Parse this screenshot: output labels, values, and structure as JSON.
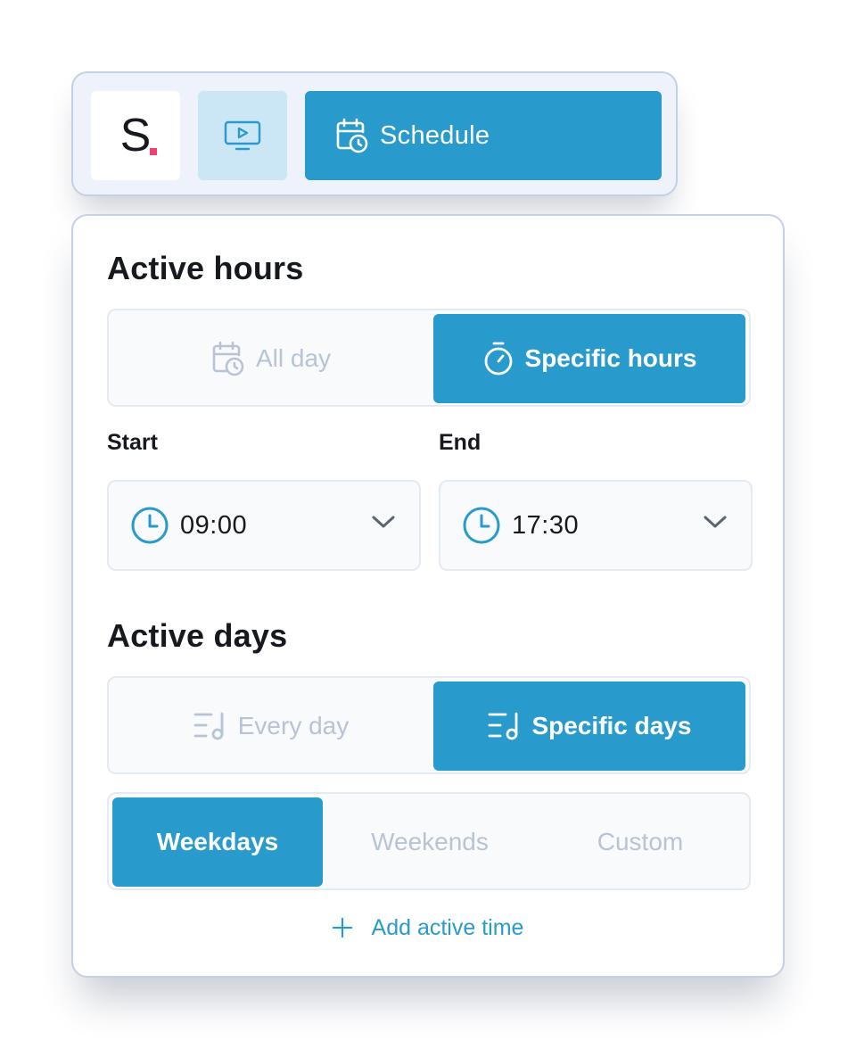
{
  "toolbar": {
    "logo_text": "S",
    "schedule_label": "Schedule"
  },
  "active_hours": {
    "title": "Active hours",
    "options": [
      {
        "label": "All day",
        "selected": false
      },
      {
        "label": "Specific hours",
        "selected": true
      }
    ],
    "start": {
      "label": "Start",
      "value": "09:00"
    },
    "end": {
      "label": "End",
      "value": "17:30"
    }
  },
  "active_days": {
    "title": "Active days",
    "options": [
      {
        "label": "Every day",
        "selected": false
      },
      {
        "label": "Specific days",
        "selected": true
      }
    ],
    "day_sets": [
      {
        "label": "Weekdays",
        "selected": true
      },
      {
        "label": "Weekends",
        "selected": false
      },
      {
        "label": "Custom",
        "selected": false
      }
    ]
  },
  "add_active_time_label": "Add active time",
  "colors": {
    "accent": "#289bcc",
    "accent_light": "#cbe6f4",
    "logo_dot": "#f03e6e",
    "inactive_text": "#b7c4d6",
    "border": "#c4d0e3"
  },
  "icons": {
    "preview": "monitor-play-icon",
    "schedule": "calendar-clock-icon",
    "all_day": "calendar-clock-icon",
    "specific_hours": "stopwatch-icon",
    "time": "clock-icon",
    "dropdown": "chevron-down-icon",
    "days": "list-music-icon",
    "add": "plus-icon"
  }
}
